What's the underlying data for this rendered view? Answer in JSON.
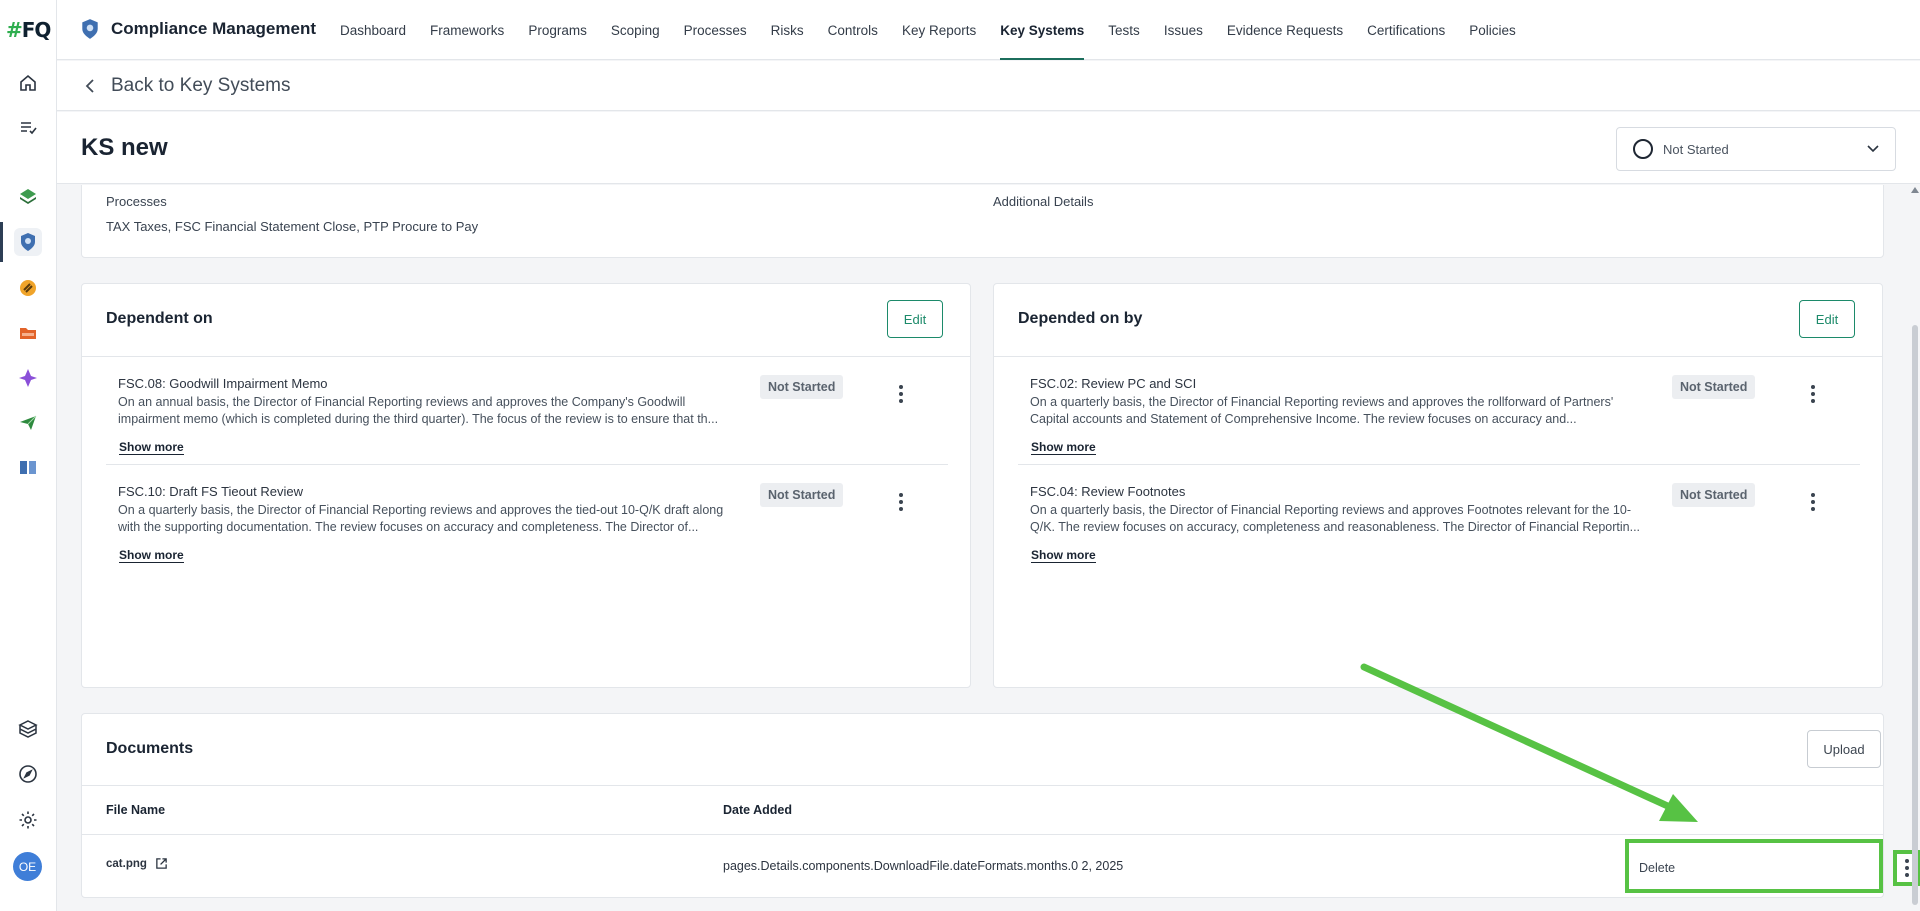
{
  "app": {
    "title": "Compliance Management",
    "logo_text": "FQ",
    "logo_hash": "#",
    "user_initials": "OE"
  },
  "nav": {
    "items": [
      {
        "label": "Dashboard"
      },
      {
        "label": "Frameworks"
      },
      {
        "label": "Programs"
      },
      {
        "label": "Scoping"
      },
      {
        "label": "Processes"
      },
      {
        "label": "Risks"
      },
      {
        "label": "Controls"
      },
      {
        "label": "Key Reports"
      },
      {
        "label": "Key Systems",
        "active": true
      },
      {
        "label": "Tests"
      },
      {
        "label": "Issues"
      },
      {
        "label": "Evidence Requests"
      },
      {
        "label": "Certifications"
      },
      {
        "label": "Policies"
      }
    ]
  },
  "back": {
    "label": "Back to Key Systems"
  },
  "page": {
    "title": "KS new",
    "status": "Not Started"
  },
  "info": {
    "processes_label": "Processes",
    "processes_value": "TAX Taxes, FSC Financial Statement Close, PTP Procure to Pay",
    "additional_label": "Additional Details"
  },
  "dependent_on": {
    "title": "Dependent on",
    "edit_label": "Edit",
    "items": [
      {
        "title": "FSC.08: Goodwill Impairment Memo",
        "desc": "On an annual basis, the Director of Financial Reporting reviews and approves the Company's Goodwill impairment memo (which is completed during the third quarter). The focus of the review is to ensure that th...",
        "status": "Not Started",
        "more": "Show more"
      },
      {
        "title": "FSC.10: Draft FS Tieout Review",
        "desc": "On a quarterly basis, the Director of Financial Reporting reviews and approves the tied-out 10-Q/K draft along with the supporting documentation. The review focuses on accuracy and completeness. The Director of...",
        "status": "Not Started",
        "more": "Show more"
      }
    ]
  },
  "depended_on_by": {
    "title": "Depended on by",
    "edit_label": "Edit",
    "items": [
      {
        "title": "FSC.02: Review PC and SCI",
        "desc": "On a quarterly basis, the Director of Financial Reporting reviews and approves the rollforward of Partners' Capital accounts and Statement of Comprehensive Income. The review focuses on accuracy and...",
        "status": "Not Started",
        "more": "Show more"
      },
      {
        "title": "FSC.04: Review Footnotes",
        "desc": "On a quarterly basis, the Director of Financial Reporting reviews and approves Footnotes relevant for the 10-Q/K. The review focuses on accuracy, completeness and reasonableness. The Director of Financial Reportin...",
        "status": "Not Started",
        "more": "Show more"
      }
    ]
  },
  "documents": {
    "title": "Documents",
    "upload_label": "Upload",
    "columns": {
      "file_name": "File Name",
      "date_added": "Date Added"
    },
    "rows": [
      {
        "file_name": "cat.png",
        "date_added": "pages.Details.components.DownloadFile.dateFormats.months.0 2, 2025"
      }
    ],
    "menu": {
      "delete_label": "Delete"
    }
  },
  "colors": {
    "accent": "#1c6e5c",
    "highlight": "#57c244",
    "avatar": "#3f7ed8"
  },
  "icons": {
    "rail": [
      "home-icon",
      "tasks-icon",
      "layers-app-icon",
      "compliance-app-icon",
      "chain-app-icon",
      "folder-app-icon",
      "diamond-app-icon",
      "plane-app-icon",
      "book-app-icon",
      "cube-icon",
      "compass-icon",
      "gear-icon"
    ]
  }
}
